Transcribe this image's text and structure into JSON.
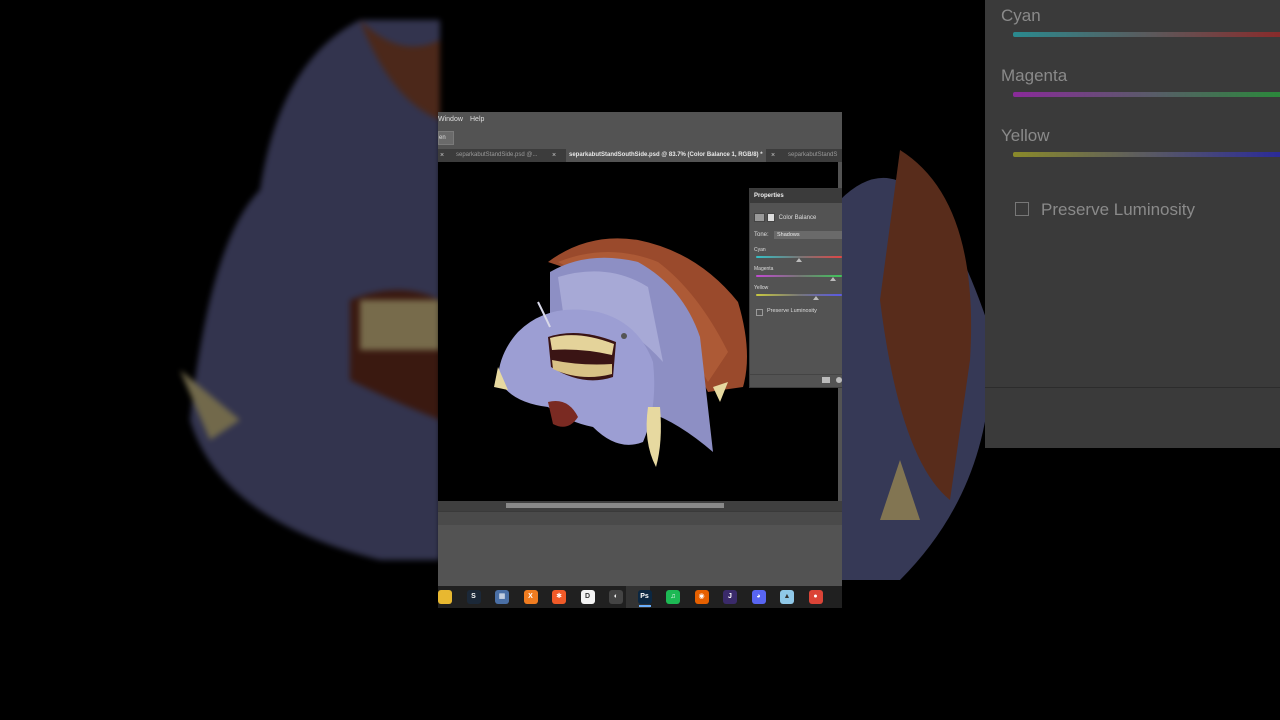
{
  "background": {
    "panel_labels": [
      "Cyan",
      "Magenta",
      "Yellow"
    ],
    "checkbox_label": "Preserve Luminosity"
  },
  "menubar": {
    "items": [
      "Window",
      "Help"
    ]
  },
  "options": {
    "button_label": "en"
  },
  "tabs": [
    {
      "label": "separkabutStandSide.psd @...",
      "active": false
    },
    {
      "label": "separkabutStandSouthSide.psd @ 83.7% (Color Balance 1, RGB/8) *",
      "active": true
    },
    {
      "label": "separkabutStandS",
      "active": false
    }
  ],
  "properties": {
    "title": "Properties",
    "adjustment": "Color Balance",
    "tone_label": "Tone:",
    "tone_value": "Shadows",
    "sliders": [
      {
        "label": "Cyan",
        "left_color": "#35c0c6",
        "right_color": "#e04646",
        "value_fraction": 0.5
      },
      {
        "label": "Magenta",
        "left_color": "#c24ad2",
        "right_color": "#3ec65a",
        "value_fraction": 0.9
      },
      {
        "label": "Yellow",
        "left_color": "#c8c840",
        "right_color": "#5a5ae6",
        "value_fraction": 0.7
      }
    ],
    "preserve_luminosity": "Preserve Luminosity"
  },
  "taskbar": {
    "icons": [
      {
        "name": "file-explorer-icon",
        "color": "#e8b830",
        "glyph": ""
      },
      {
        "name": "steam-icon",
        "color": "#1b2838",
        "glyph": "S"
      },
      {
        "name": "calculator-icon",
        "color": "#4a6fa5",
        "glyph": "▦"
      },
      {
        "name": "xodo-icon",
        "color": "#f07c20",
        "glyph": "X"
      },
      {
        "name": "orange-app-icon",
        "color": "#f05a28",
        "glyph": "✱"
      },
      {
        "name": "document-icon",
        "color": "#f3f3f3",
        "glyph": "D"
      },
      {
        "name": "chrome-dark-icon",
        "color": "#444",
        "glyph": "◐"
      },
      {
        "name": "photoshop-icon",
        "color": "#0b2742",
        "glyph": "Ps",
        "active": true
      },
      {
        "name": "spotify-icon",
        "color": "#1db954",
        "glyph": "♫"
      },
      {
        "name": "firefox-icon",
        "color": "#e66000",
        "glyph": "◉"
      },
      {
        "name": "jetbrains-icon",
        "color": "#3a2a6a",
        "glyph": "J"
      },
      {
        "name": "discord-icon",
        "color": "#5865f2",
        "glyph": "◕"
      },
      {
        "name": "app-icon",
        "color": "#8fc8e8",
        "glyph": "▲"
      },
      {
        "name": "chrome-icon",
        "color": "#db4437",
        "glyph": "●"
      }
    ]
  }
}
